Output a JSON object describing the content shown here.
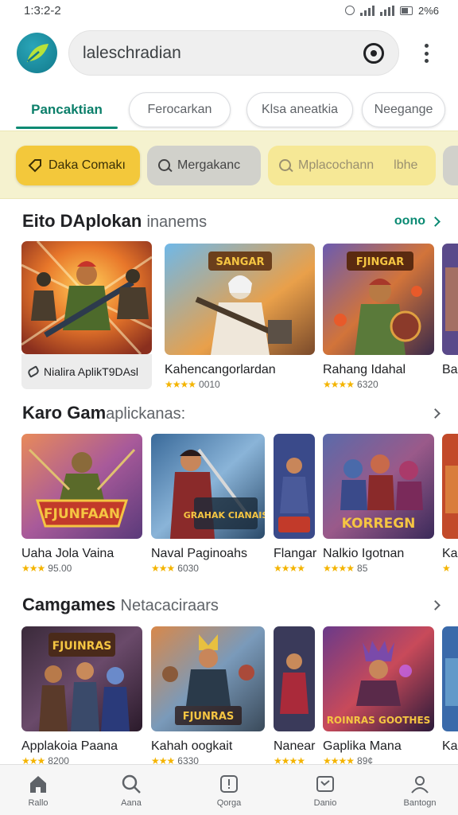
{
  "status_bar": {
    "time": "1:3:2-2",
    "battery_text": "2%6"
  },
  "search": {
    "query": "laleschradian"
  },
  "tabs": [
    {
      "label": "Pancaktian",
      "active": true
    },
    {
      "label": "Ferocarkan",
      "active": false
    },
    {
      "label": "Klsa aneatkia",
      "active": false
    },
    {
      "label": "Neegange",
      "active": false
    }
  ],
  "chips": [
    {
      "label": "Daka Comakı"
    },
    {
      "label": "Mergakanc"
    },
    {
      "label": "Mplacochann",
      "extra": "lbhe"
    },
    {
      "label": ""
    }
  ],
  "sections": [
    {
      "title": "Eito DAplokan",
      "subtitle": "inanems",
      "more_label": "oono",
      "featured_caption": "Nialira AplikT9DAsl",
      "cards": [
        {
          "name": "Kahencangorlardan",
          "rating": "0010",
          "stars": 4
        },
        {
          "name": "Rahang Idahal",
          "rating": "6320",
          "stars": 4
        },
        {
          "name": "Ba",
          "rating": "",
          "stars": 0
        }
      ]
    },
    {
      "title": "Karo Gam",
      "subtitle": "aplickanas:",
      "cards": [
        {
          "name": "Uaha Jola Vaina",
          "rating": "95.00",
          "stars": 3
        },
        {
          "name": "Naval Paginoahs",
          "rating": "6030",
          "stars": 3
        },
        {
          "name": "Flangar",
          "rating": "",
          "stars": 4
        },
        {
          "name": "Nalkio Igotnan",
          "rating": "85",
          "stars": 4
        },
        {
          "name": "Ka",
          "rating": "",
          "stars": 1
        }
      ]
    },
    {
      "title": "Camgames",
      "subtitle": "Netacaciraars",
      "cards": [
        {
          "name": "Applakoia Paana",
          "rating": "8200",
          "stars": 3
        },
        {
          "name": "Kahah oogkait",
          "rating": "6330",
          "stars": 3
        },
        {
          "name": "Nanear",
          "rating": "",
          "stars": 4
        },
        {
          "name": "Gaplika Mana",
          "rating": "89¢",
          "stars": 4
        },
        {
          "name": "Ka",
          "rating": "",
          "stars": 0
        }
      ]
    }
  ],
  "art_titles": [
    "SANGAR",
    "FJINGAR",
    "FJUNFAAN",
    "GRAHAK CIANAIS",
    "KORREGN",
    "FJUINRAS",
    "FJUNRAS",
    "ROINRAS GOOTHES"
  ],
  "bottom_nav": [
    {
      "label": "Rallo",
      "icon": "home-icon"
    },
    {
      "label": "Aana",
      "icon": "search-icon"
    },
    {
      "label": "Qorga",
      "icon": "alert-icon"
    },
    {
      "label": "Danio",
      "icon": "library-icon"
    },
    {
      "label": "Bantogn",
      "icon": "profile-icon"
    }
  ],
  "colors": {
    "accent": "#0b8a73",
    "chip_active": "#f3c83b",
    "chip_band": "#f5f2cf",
    "star": "#f4b400"
  }
}
